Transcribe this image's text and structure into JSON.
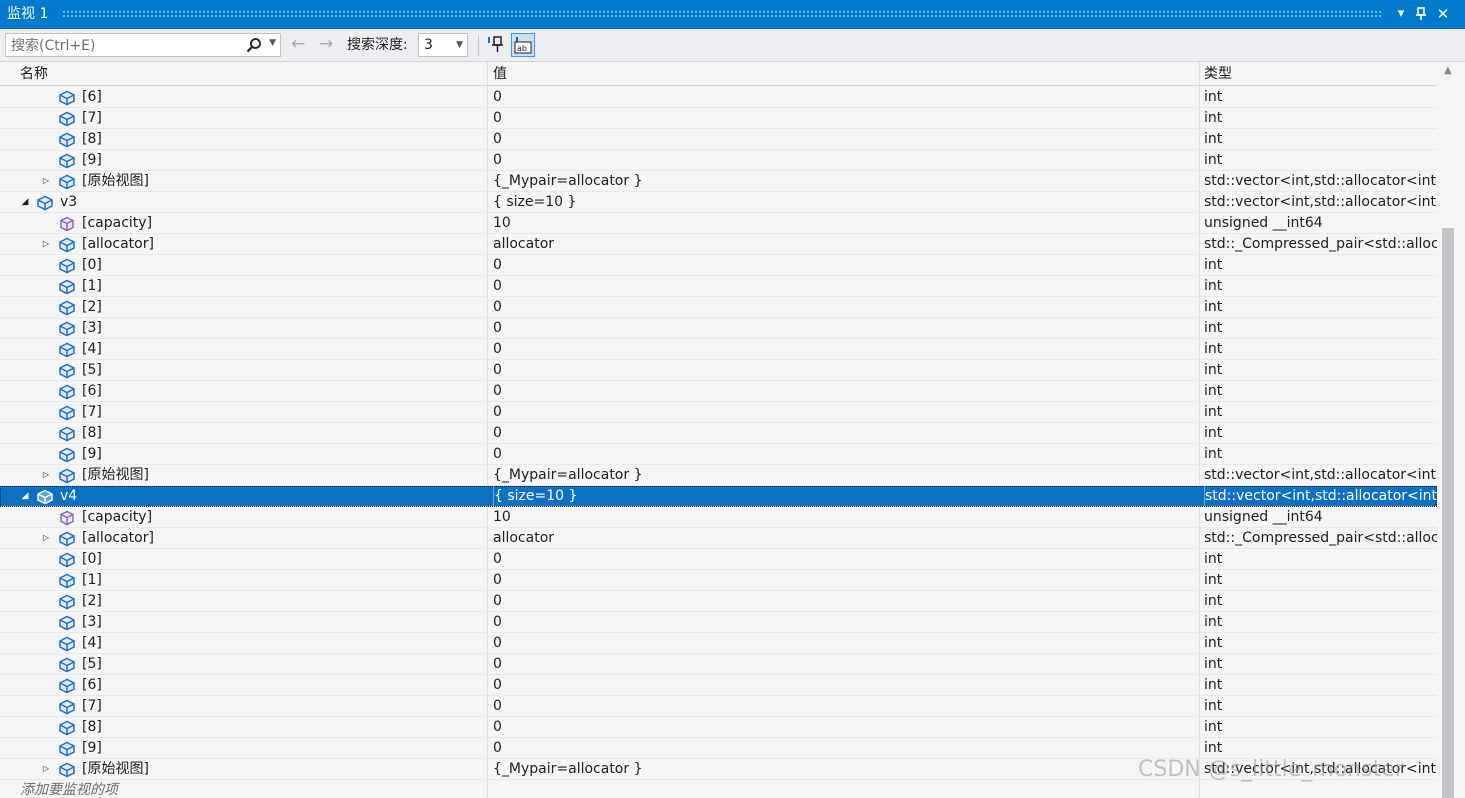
{
  "window": {
    "title": "监视 1",
    "dropdown_icon": "chevron-down-icon",
    "pin_icon": "pin-icon",
    "close_icon": "close-icon"
  },
  "toolbar": {
    "search_placeholder": "搜索(Ctrl+E)",
    "search_icon": "search-icon",
    "back_icon": "arrow-left-icon",
    "forward_icon": "arrow-right-icon",
    "depth_label": "搜索深度:",
    "depth_value": "3",
    "pin_button_icon": "pin-to-source-icon",
    "hex_button_icon": "ab-format-icon"
  },
  "columns": {
    "name": "名称",
    "value": "值",
    "type": "类型"
  },
  "rows": [
    {
      "indent": 2,
      "expander": "",
      "icon": "field",
      "name": "[6]",
      "value": "0",
      "type": "int"
    },
    {
      "indent": 2,
      "expander": "",
      "icon": "field",
      "name": "[7]",
      "value": "0",
      "type": "int"
    },
    {
      "indent": 2,
      "expander": "",
      "icon": "field",
      "name": "[8]",
      "value": "0",
      "type": "int"
    },
    {
      "indent": 2,
      "expander": "",
      "icon": "field",
      "name": "[9]",
      "value": "0",
      "type": "int"
    },
    {
      "indent": 2,
      "expander": "collapsed",
      "icon": "field",
      "name": "[原始视图]",
      "value": "{_Mypair=allocator }",
      "type": "std::vector<int,std::allocator<int> >"
    },
    {
      "indent": 1,
      "expander": "expanded",
      "icon": "field",
      "name": "v3",
      "value": "{ size=10 }",
      "type": "std::vector<int,std::allocator<int> >"
    },
    {
      "indent": 2,
      "expander": "",
      "icon": "property",
      "name": "[capacity]",
      "value": "10",
      "type": "unsigned __int64"
    },
    {
      "indent": 2,
      "expander": "collapsed",
      "icon": "field",
      "name": "[allocator]",
      "value": "allocator",
      "type": "std::_Compressed_pair<std::alloca..."
    },
    {
      "indent": 2,
      "expander": "",
      "icon": "field",
      "name": "[0]",
      "value": "0",
      "type": "int"
    },
    {
      "indent": 2,
      "expander": "",
      "icon": "field",
      "name": "[1]",
      "value": "0",
      "type": "int"
    },
    {
      "indent": 2,
      "expander": "",
      "icon": "field",
      "name": "[2]",
      "value": "0",
      "type": "int"
    },
    {
      "indent": 2,
      "expander": "",
      "icon": "field",
      "name": "[3]",
      "value": "0",
      "type": "int"
    },
    {
      "indent": 2,
      "expander": "",
      "icon": "field",
      "name": "[4]",
      "value": "0",
      "type": "int"
    },
    {
      "indent": 2,
      "expander": "",
      "icon": "field",
      "name": "[5]",
      "value": "0",
      "type": "int"
    },
    {
      "indent": 2,
      "expander": "",
      "icon": "field",
      "name": "[6]",
      "value": "0",
      "type": "int"
    },
    {
      "indent": 2,
      "expander": "",
      "icon": "field",
      "name": "[7]",
      "value": "0",
      "type": "int"
    },
    {
      "indent": 2,
      "expander": "",
      "icon": "field",
      "name": "[8]",
      "value": "0",
      "type": "int"
    },
    {
      "indent": 2,
      "expander": "",
      "icon": "field",
      "name": "[9]",
      "value": "0",
      "type": "int"
    },
    {
      "indent": 2,
      "expander": "collapsed",
      "icon": "field",
      "name": "[原始视图]",
      "value": "{_Mypair=allocator }",
      "type": "std::vector<int,std::allocator<int> >"
    },
    {
      "indent": 1,
      "expander": "expanded",
      "icon": "field",
      "name": "v4",
      "value": "{ size=10 }",
      "type": "std::vector<int,std::allocator<int> >",
      "selected": true
    },
    {
      "indent": 2,
      "expander": "",
      "icon": "property",
      "name": "[capacity]",
      "value": "10",
      "type": "unsigned __int64"
    },
    {
      "indent": 2,
      "expander": "collapsed",
      "icon": "field",
      "name": "[allocator]",
      "value": "allocator",
      "type": "std::_Compressed_pair<std::alloca..."
    },
    {
      "indent": 2,
      "expander": "",
      "icon": "field",
      "name": "[0]",
      "value": "0",
      "type": "int"
    },
    {
      "indent": 2,
      "expander": "",
      "icon": "field",
      "name": "[1]",
      "value": "0",
      "type": "int"
    },
    {
      "indent": 2,
      "expander": "",
      "icon": "field",
      "name": "[2]",
      "value": "0",
      "type": "int"
    },
    {
      "indent": 2,
      "expander": "",
      "icon": "field",
      "name": "[3]",
      "value": "0",
      "type": "int"
    },
    {
      "indent": 2,
      "expander": "",
      "icon": "field",
      "name": "[4]",
      "value": "0",
      "type": "int"
    },
    {
      "indent": 2,
      "expander": "",
      "icon": "field",
      "name": "[5]",
      "value": "0",
      "type": "int"
    },
    {
      "indent": 2,
      "expander": "",
      "icon": "field",
      "name": "[6]",
      "value": "0",
      "type": "int"
    },
    {
      "indent": 2,
      "expander": "",
      "icon": "field",
      "name": "[7]",
      "value": "0",
      "type": "int"
    },
    {
      "indent": 2,
      "expander": "",
      "icon": "field",
      "name": "[8]",
      "value": "0",
      "type": "int"
    },
    {
      "indent": 2,
      "expander": "",
      "icon": "field",
      "name": "[9]",
      "value": "0",
      "type": "int"
    },
    {
      "indent": 2,
      "expander": "collapsed",
      "icon": "field",
      "name": "[原始视图]",
      "value": "{_Mypair=allocator }",
      "type": "std::vector<int,std::allocator<int> >"
    }
  ],
  "add_item_placeholder": "添加要监视的项",
  "watermark": "CSDN @s_little_monster",
  "colors": {
    "title_bar": "#007acc",
    "selection": "#0e70c0",
    "field_icon": "#1c72c4",
    "property_icon": "#8a5cb8"
  }
}
